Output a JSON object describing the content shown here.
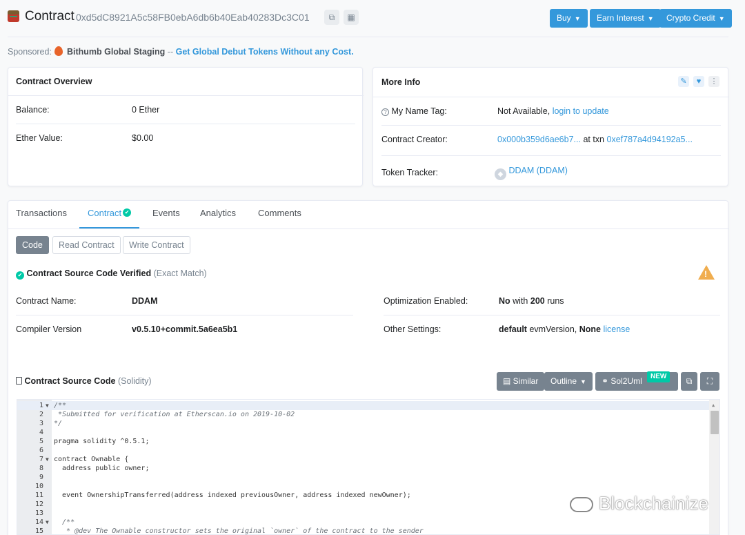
{
  "header": {
    "title": "Contract",
    "address": "0xd5dC8921A5c58FB0ebA6db6b40Eab40283Dc3C01",
    "buttons": [
      "Buy",
      "Earn Interest",
      "Crypto Credit"
    ]
  },
  "sponsor": {
    "label": "Sponsored:",
    "name": "Bithumb Global Staging",
    "separator": "--",
    "tagline": "Get Global Debut Tokens Without any Cost."
  },
  "overview": {
    "title": "Contract Overview",
    "balance_label": "Balance:",
    "balance_value": "0 Ether",
    "ether_value_label": "Ether Value:",
    "ether_value": "$0.00"
  },
  "more_info": {
    "title": "More Info",
    "name_tag_label": "My Name Tag:",
    "name_tag_value": "Not Available,",
    "name_tag_link": "login to update",
    "creator_label": "Contract Creator:",
    "creator_address": "0x000b359d6ae6b7...",
    "creator_at_txn": "at txn",
    "creator_txn": "0xef787a4d94192a5...",
    "token_tracker_label": "Token Tracker:",
    "token_tracker_value": "DDAM (DDAM)"
  },
  "tabs": [
    "Transactions",
    "Contract",
    "Events",
    "Analytics",
    "Comments"
  ],
  "active_tab": "Contract",
  "sub_tabs": [
    "Code",
    "Read Contract",
    "Write Contract"
  ],
  "verified": {
    "title": "Contract Source Code Verified",
    "match": "(Exact Match)"
  },
  "contract_info": {
    "name_label": "Contract Name:",
    "name_value": "DDAM",
    "compiler_label": "Compiler Version",
    "compiler_value": "v0.5.10+commit.5a6ea5b1",
    "optimization_label": "Optimization Enabled:",
    "optimization_no": "No",
    "optimization_with": "with",
    "optimization_runs": "200",
    "optimization_runs_label": "runs",
    "other_label": "Other Settings:",
    "other_default": "default",
    "other_evm": "evmVersion,",
    "other_none": "None",
    "other_license": "license"
  },
  "source": {
    "title": "Contract Source Code",
    "lang": "(Solidity)",
    "buttons": {
      "similar": "Similar",
      "outline": "Outline",
      "sol2uml": "Sol2Uml",
      "new_badge": "NEW"
    }
  },
  "code_lines": [
    {
      "n": "1",
      "fold": true,
      "text": "/**",
      "comment": true,
      "active": true
    },
    {
      "n": "2",
      "fold": false,
      "text": " *Submitted for verification at Etherscan.io on 2019-10-02",
      "comment": true
    },
    {
      "n": "3",
      "fold": false,
      "text": "*/",
      "comment": true
    },
    {
      "n": "4",
      "fold": false,
      "text": ""
    },
    {
      "n": "5",
      "fold": false,
      "text": "pragma solidity ^0.5.1;"
    },
    {
      "n": "6",
      "fold": false,
      "text": ""
    },
    {
      "n": "7",
      "fold": true,
      "text": "contract Ownable {"
    },
    {
      "n": "8",
      "fold": false,
      "text": "  address public owner;"
    },
    {
      "n": "9",
      "fold": false,
      "text": ""
    },
    {
      "n": "10",
      "fold": false,
      "text": ""
    },
    {
      "n": "11",
      "fold": false,
      "text": "  event OwnershipTransferred(address indexed previousOwner, address indexed newOwner);"
    },
    {
      "n": "12",
      "fold": false,
      "text": ""
    },
    {
      "n": "13",
      "fold": false,
      "text": ""
    },
    {
      "n": "14",
      "fold": true,
      "text": "  /**",
      "comment": true
    },
    {
      "n": "15",
      "fold": false,
      "text": "   * @dev The Ownable constructor sets the original `owner` of the contract to the sender",
      "comment": true
    }
  ],
  "watermark": "Blockchainize",
  "colors": {
    "accent": "#3498db",
    "success": "#00c9a7",
    "warning": "#f0ad4e",
    "muted": "#77838f"
  }
}
